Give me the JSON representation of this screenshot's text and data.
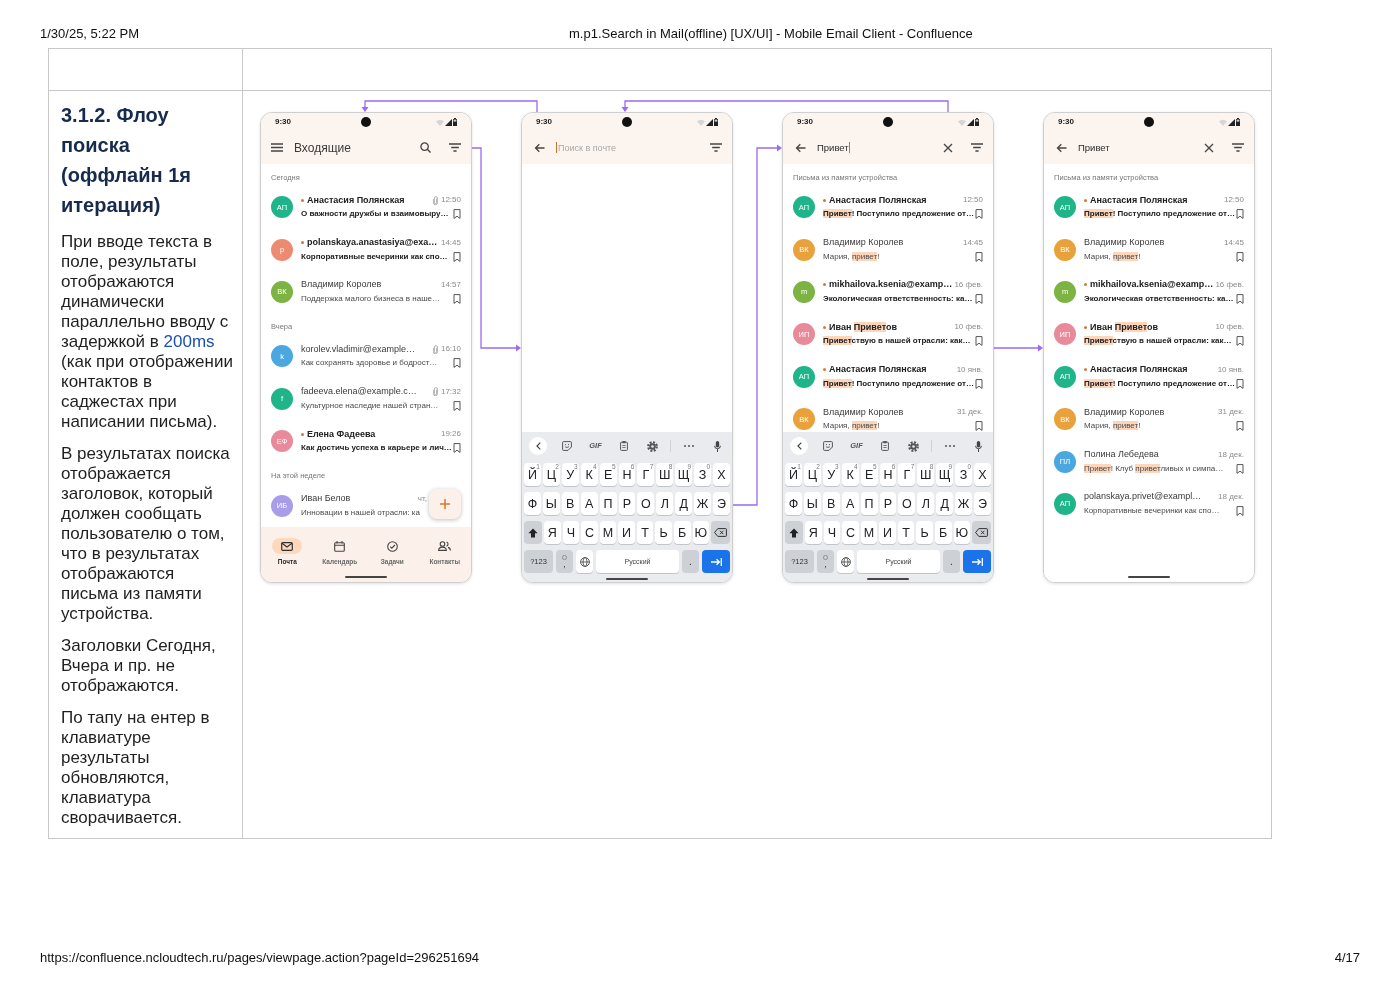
{
  "print_header": {
    "date": "1/30/25, 5:22 PM",
    "title": "m.p1.Search in Mail(offline) [UX/UI] - Mobile Email Client - Confluence"
  },
  "section": {
    "heading": "3.1.2. Флоу поиска (оффлайн 1я итерация)",
    "paragraphs": [
      [
        {
          "text": "При вводе текста в поле, результаты отображаются динамически параллельно вводу с задержкой в ",
          "accent": false
        },
        {
          "text": "200ms",
          "accent": true
        },
        {
          "text": " (как при отображении контактов в саджестах при написании письма).",
          "accent": false
        }
      ],
      [
        {
          "text": "В результатах поиска отображается заголовок, который должен сообщать пользователю о том, что в результатах отображаются письма из памяти устройства.",
          "accent": false
        }
      ],
      [
        {
          "text": "Заголовки Сегодня, Вчера и пр. не отображаются.",
          "accent": false
        }
      ],
      [
        {
          "text": "По тапу на ентер в клавиатуре результаты обновляются, клавиатура сворачивается.",
          "accent": false
        }
      ]
    ]
  },
  "screens": [
    {
      "kind": "inbox",
      "status_time": "9:30",
      "title": "Входящие",
      "sections": [
        {
          "label": "Сегодня",
          "emails": [
            {
              "initials": "АП",
              "color": "#1fb489",
              "unread": true,
              "sender": "Анастасия Полянская",
              "attachment": true,
              "time": "12:50",
              "snippet": "О важности дружбы и взаимовыру…"
            },
            {
              "initials": "p",
              "color": "#ec8a72",
              "unread": true,
              "sender": "polanskaya.anastasiya@exa…",
              "attachment": false,
              "time": "14:45",
              "snippet": "Корпоративные вечеринки как спо…"
            },
            {
              "initials": "ВК",
              "color": "#7db343",
              "unread": false,
              "sender": "Владимир Королев",
              "attachment": false,
              "time": "14:57",
              "snippet": "Поддержка малого бизнеса в наше…"
            }
          ]
        },
        {
          "label": "Вчера",
          "emails": [
            {
              "initials": "k",
              "color": "#4ba7e0",
              "unread": false,
              "sender": "korolev.vladimir@example…",
              "attachment": true,
              "time": "16:10",
              "snippet": "Как сохранять здоровье и бодрост…"
            },
            {
              "initials": "f",
              "color": "#1fb489",
              "unread": false,
              "sender": "fadeeva.elena@example.c…",
              "attachment": true,
              "time": "17:32",
              "snippet": "Культурное наследие нашей стран…"
            },
            {
              "initials": "ЕФ",
              "color": "#e98a9b",
              "unread": true,
              "sender": "Елена Фадеева",
              "attachment": false,
              "time": "19:26",
              "snippet": "Как достичь успеха в карьере и лич…"
            }
          ]
        },
        {
          "label": "На этой неделе",
          "emails": [
            {
              "initials": "ИБ",
              "color": "#a99de9",
              "unread": false,
              "sender": "Иван Белов",
              "attachment": false,
              "time": "чт,",
              "snippet": "Инновации в нашей отрасли: ка"
            }
          ]
        }
      ],
      "nav": [
        {
          "label": "Почта",
          "selected": true
        },
        {
          "label": "Календарь",
          "selected": false
        },
        {
          "label": "Задачи",
          "selected": false
        },
        {
          "label": "Контакты",
          "selected": false
        }
      ]
    },
    {
      "kind": "search",
      "status_time": "9:30",
      "search": {
        "placeholder": "Поиск в почте",
        "focused": true
      },
      "keyboard": {
        "gif_label": "GIF",
        "rows": [
          [
            {
              "kind": "letter",
              "label": "Й",
              "hint": "1"
            },
            {
              "kind": "letter",
              "label": "Ц",
              "hint": "2"
            },
            {
              "kind": "letter",
              "label": "У",
              "hint": "3"
            },
            {
              "kind": "letter",
              "label": "К",
              "hint": "4"
            },
            {
              "kind": "letter",
              "label": "Е",
              "hint": "5"
            },
            {
              "kind": "letter",
              "label": "Н",
              "hint": "6"
            },
            {
              "kind": "letter",
              "label": "Г",
              "hint": "7"
            },
            {
              "kind": "letter",
              "label": "Ш",
              "hint": "8"
            },
            {
              "kind": "letter",
              "label": "Щ",
              "hint": "9"
            },
            {
              "kind": "letter",
              "label": "З",
              "hint": "0"
            },
            {
              "kind": "letter",
              "label": "Х"
            }
          ],
          [
            {
              "kind": "letter",
              "label": "Ф"
            },
            {
              "kind": "letter",
              "label": "Ы"
            },
            {
              "kind": "letter",
              "label": "В"
            },
            {
              "kind": "letter",
              "label": "А"
            },
            {
              "kind": "letter",
              "label": "П"
            },
            {
              "kind": "letter",
              "label": "Р"
            },
            {
              "kind": "letter",
              "label": "О"
            },
            {
              "kind": "letter",
              "label": "Л"
            },
            {
              "kind": "letter",
              "label": "Д"
            },
            {
              "kind": "letter",
              "label": "Ж"
            },
            {
              "kind": "letter",
              "label": "Э"
            }
          ],
          [
            {
              "kind": "shift"
            },
            {
              "kind": "letter",
              "label": "Я"
            },
            {
              "kind": "letter",
              "label": "Ч"
            },
            {
              "kind": "letter",
              "label": "С"
            },
            {
              "kind": "letter",
              "label": "М"
            },
            {
              "kind": "letter",
              "label": "И"
            },
            {
              "kind": "letter",
              "label": "Т"
            },
            {
              "kind": "letter",
              "label": "Ь"
            },
            {
              "kind": "letter",
              "label": "Б"
            },
            {
              "kind": "letter",
              "label": "Ю"
            },
            {
              "kind": "backspace"
            }
          ]
        ],
        "bottom_row": {
          "symbols": "?123",
          "comma": ",",
          "space": "Русский",
          "period": "."
        }
      }
    },
    {
      "kind": "search",
      "status_time": "9:30",
      "search": {
        "value": "Привет",
        "focused": true
      },
      "sections": [
        {
          "label": "Письма из памяти устройства",
          "emails": [
            {
              "initials": "АП",
              "color": "#1fb489",
              "unread": true,
              "sender": [
                {
                  "text": "Анастасия Полянская",
                  "match": false
                }
              ],
              "attachment": false,
              "time": "12:50",
              "snippet": [
                {
                  "text": "Привет",
                  "match": true
                },
                {
                  "text": "! Поступило предложение от…",
                  "match": false
                }
              ]
            },
            {
              "initials": "ВК",
              "color": "#e9a23b",
              "unread": false,
              "sender": [
                {
                  "text": "Владимир Королев",
                  "match": false
                }
              ],
              "attachment": false,
              "time": "14:45",
              "snippet": [
                {
                  "text": "Мария, ",
                  "match": false
                },
                {
                  "text": "привет",
                  "match": true
                },
                {
                  "text": "!",
                  "match": false
                }
              ]
            },
            {
              "initials": "m",
              "color": "#7db343",
              "unread": true,
              "sender": [
                {
                  "text": "mikhailova.ksenia@examp…",
                  "match": false
                }
              ],
              "attachment": false,
              "time": "16 фев.",
              "snippet": [
                {
                  "text": "Экологическая ответственность: ка…",
                  "match": false
                }
              ]
            },
            {
              "initials": "ИП",
              "color": "#e98a9b",
              "unread": true,
              "sender": [
                {
                  "text": "Иван ",
                  "match": false
                },
                {
                  "text": "Привет",
                  "match": true
                },
                {
                  "text": "ов",
                  "match": false
                }
              ],
              "attachment": false,
              "time": "10 фев.",
              "snippet": [
                {
                  "text": "Привет",
                  "match": true
                },
                {
                  "text": "ствую в нашей отрасли: как…",
                  "match": false
                }
              ]
            },
            {
              "initials": "АП",
              "color": "#1fb489",
              "unread": true,
              "sender": [
                {
                  "text": "Анастасия Полянская",
                  "match": false
                }
              ],
              "attachment": false,
              "time": "10 янв.",
              "snippet": [
                {
                  "text": "Привет",
                  "match": true
                },
                {
                  "text": "! Поступило предложение от…",
                  "match": false
                }
              ]
            },
            {
              "initials": "ВК",
              "color": "#e9a23b",
              "unread": false,
              "sender": [
                {
                  "text": "Владимир Королев",
                  "match": false
                }
              ],
              "attachment": false,
              "time": "31 дек.",
              "snippet": [
                {
                  "text": "Мария, ",
                  "match": false
                },
                {
                  "text": "привет",
                  "match": true
                },
                {
                  "text": "!",
                  "match": false
                }
              ]
            }
          ]
        }
      ],
      "keyboard": {
        "gif_label": "GIF",
        "rows": [
          [
            {
              "kind": "letter",
              "label": "Й",
              "hint": "1"
            },
            {
              "kind": "letter",
              "label": "Ц",
              "hint": "2"
            },
            {
              "kind": "letter",
              "label": "У",
              "hint": "3"
            },
            {
              "kind": "letter",
              "label": "К",
              "hint": "4"
            },
            {
              "kind": "letter",
              "label": "Е",
              "hint": "5"
            },
            {
              "kind": "letter",
              "label": "Н",
              "hint": "6"
            },
            {
              "kind": "letter",
              "label": "Г",
              "hint": "7"
            },
            {
              "kind": "letter",
              "label": "Ш",
              "hint": "8"
            },
            {
              "kind": "letter",
              "label": "Щ",
              "hint": "9"
            },
            {
              "kind": "letter",
              "label": "З",
              "hint": "0"
            },
            {
              "kind": "letter",
              "label": "Х"
            }
          ],
          [
            {
              "kind": "letter",
              "label": "Ф"
            },
            {
              "kind": "letter",
              "label": "Ы"
            },
            {
              "kind": "letter",
              "label": "В"
            },
            {
              "kind": "letter",
              "label": "А"
            },
            {
              "kind": "letter",
              "label": "П"
            },
            {
              "kind": "letter",
              "label": "Р"
            },
            {
              "kind": "letter",
              "label": "О"
            },
            {
              "kind": "letter",
              "label": "Л"
            },
            {
              "kind": "letter",
              "label": "Д"
            },
            {
              "kind": "letter",
              "label": "Ж"
            },
            {
              "kind": "letter",
              "label": "Э"
            }
          ],
          [
            {
              "kind": "shift"
            },
            {
              "kind": "letter",
              "label": "Я"
            },
            {
              "kind": "letter",
              "label": "Ч"
            },
            {
              "kind": "letter",
              "label": "С"
            },
            {
              "kind": "letter",
              "label": "М"
            },
            {
              "kind": "letter",
              "label": "И"
            },
            {
              "kind": "letter",
              "label": "Т"
            },
            {
              "kind": "letter",
              "label": "Ь"
            },
            {
              "kind": "letter",
              "label": "Б"
            },
            {
              "kind": "letter",
              "label": "Ю"
            },
            {
              "kind": "backspace"
            }
          ]
        ],
        "bottom_row": {
          "symbols": "?123",
          "comma": ",",
          "space": "Русский",
          "period": "."
        }
      }
    },
    {
      "kind": "search",
      "status_time": "9:30",
      "search": {
        "value": "Привет",
        "focused": false
      },
      "sections": [
        {
          "label": "Письма из памяти устройства",
          "emails": [
            {
              "initials": "АП",
              "color": "#1fb489",
              "unread": true,
              "sender": [
                {
                  "text": "Анастасия Полянская",
                  "match": false
                }
              ],
              "attachment": false,
              "time": "12:50",
              "snippet": [
                {
                  "text": "Привет",
                  "match": true
                },
                {
                  "text": "! Поступило предложение от…",
                  "match": false
                }
              ]
            },
            {
              "initials": "ВК",
              "color": "#e9a23b",
              "unread": false,
              "sender": [
                {
                  "text": "Владимир Королев",
                  "match": false
                }
              ],
              "attachment": false,
              "time": "14:45",
              "snippet": [
                {
                  "text": "Мария, ",
                  "match": false
                },
                {
                  "text": "привет",
                  "match": true
                },
                {
                  "text": "!",
                  "match": false
                }
              ]
            },
            {
              "initials": "m",
              "color": "#7db343",
              "unread": true,
              "sender": [
                {
                  "text": "mikhailova.ksenia@examp…",
                  "match": false
                }
              ],
              "attachment": false,
              "time": "16 фев.",
              "snippet": [
                {
                  "text": "Экологическая ответственность: ка…",
                  "match": false
                }
              ]
            },
            {
              "initials": "ИП",
              "color": "#e98a9b",
              "unread": true,
              "sender": [
                {
                  "text": "Иван ",
                  "match": false
                },
                {
                  "text": "Привет",
                  "match": true
                },
                {
                  "text": "ов",
                  "match": false
                }
              ],
              "attachment": false,
              "time": "10 фев.",
              "snippet": [
                {
                  "text": "Привет",
                  "match": true
                },
                {
                  "text": "ствую в нашей отрасли: как…",
                  "match": false
                }
              ]
            },
            {
              "initials": "АП",
              "color": "#1fb489",
              "unread": true,
              "sender": [
                {
                  "text": "Анастасия Полянская",
                  "match": false
                }
              ],
              "attachment": false,
              "time": "10 янв.",
              "snippet": [
                {
                  "text": "Привет",
                  "match": true
                },
                {
                  "text": "! Поступило предложение от…",
                  "match": false
                }
              ]
            },
            {
              "initials": "ВК",
              "color": "#e9a23b",
              "unread": false,
              "sender": [
                {
                  "text": "Владимир Королев",
                  "match": false
                }
              ],
              "attachment": false,
              "time": "31 дек.",
              "snippet": [
                {
                  "text": "Мария, ",
                  "match": false
                },
                {
                  "text": "привет",
                  "match": true
                },
                {
                  "text": "!",
                  "match": false
                }
              ]
            },
            {
              "initials": "ПЛ",
              "color": "#4ba7e0",
              "unread": false,
              "sender": [
                {
                  "text": "Полина Лебедева",
                  "match": false
                }
              ],
              "attachment": false,
              "time": "18 дек.",
              "snippet": [
                {
                  "text": "Привет",
                  "match": true
                },
                {
                  "text": "! Клуб ",
                  "match": false
                },
                {
                  "text": "привет",
                  "match": true
                },
                {
                  "text": "ливых и симпа…",
                  "match": false
                }
              ]
            },
            {
              "initials": "АП",
              "color": "#1fb489",
              "unread": false,
              "sender": [
                {
                  "text": "polanskaya.privet@exampl…",
                  "match": false
                }
              ],
              "attachment": false,
              "time": "18 дек.",
              "snippet": [
                {
                  "text": "Корпоративные вечеринки как спо…",
                  "match": false
                }
              ]
            }
          ]
        }
      ]
    }
  ],
  "print_footer": {
    "url": "https://confluence.ncloudtech.ru/pages/viewpage.action?pageId=296251694",
    "page": "4/17"
  }
}
